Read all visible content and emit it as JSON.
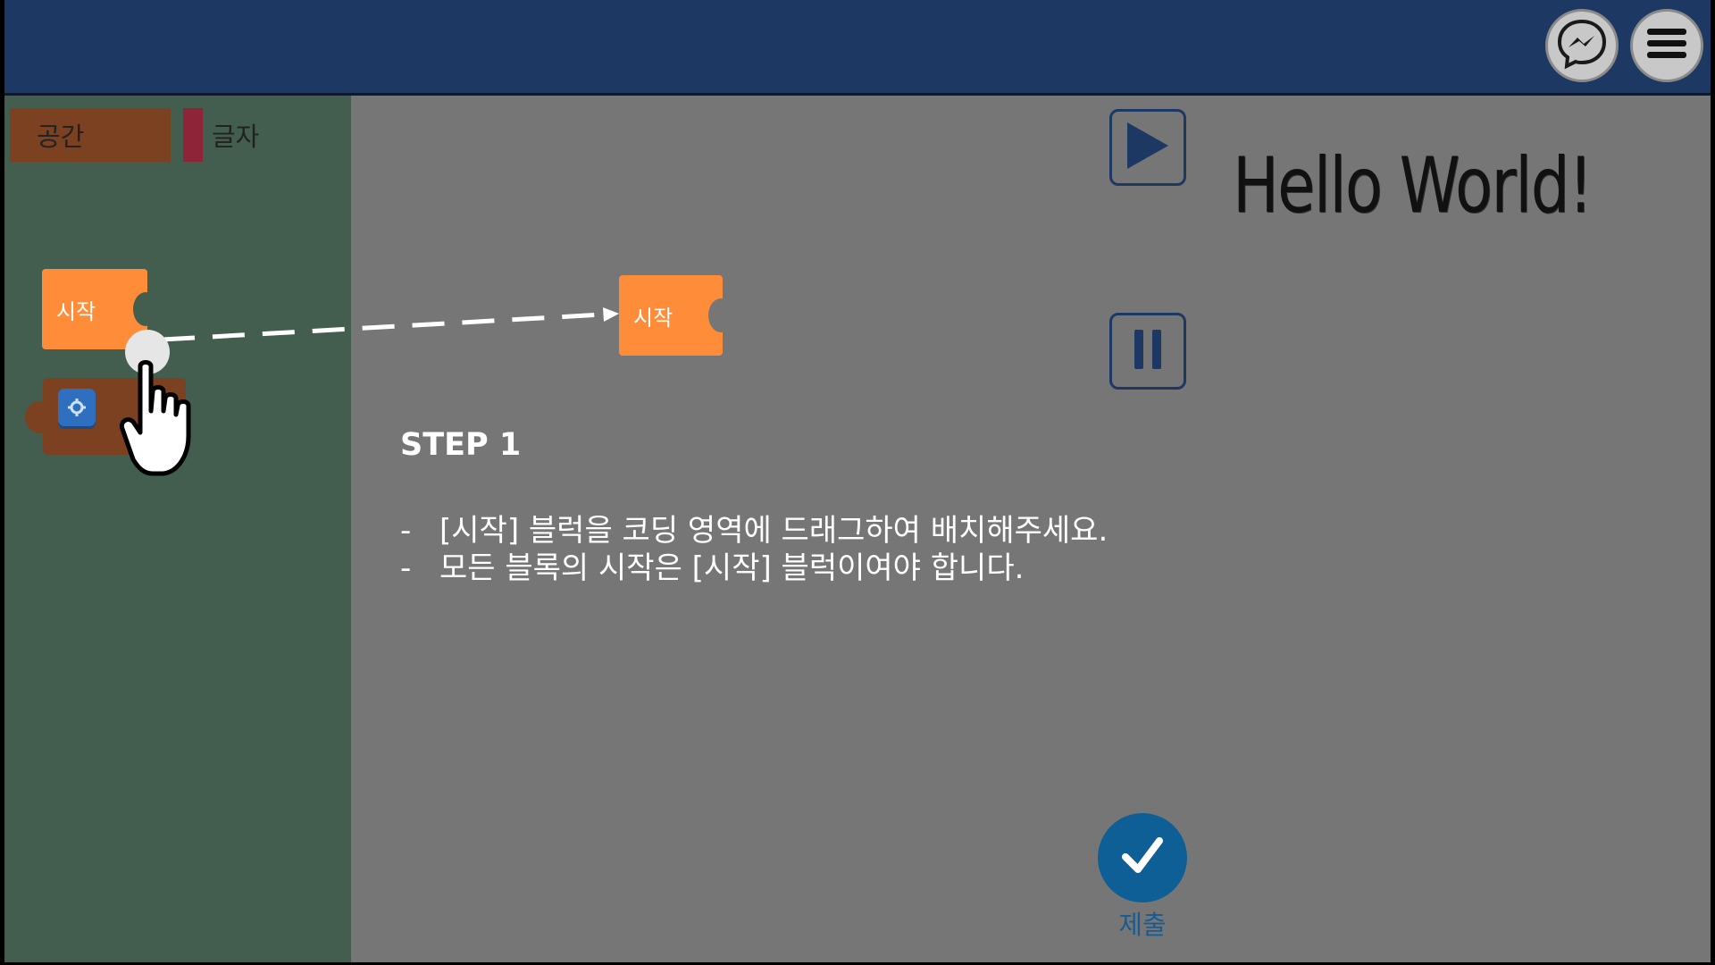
{
  "sidebar": {
    "categories": [
      {
        "label": "공간",
        "color": "#7b4120"
      },
      {
        "label": "글자",
        "color": "#8e2437"
      }
    ],
    "blocks": [
      {
        "label": "시작",
        "color": "#ff8c39"
      }
    ]
  },
  "workspace": {
    "placed_block": {
      "label": "시작"
    },
    "output_text": "Hello World!"
  },
  "controls": {
    "play_icon": "play-icon",
    "pause_icon": "pause-icon"
  },
  "header": {
    "icons": [
      "messenger-icon",
      "menu-icon"
    ]
  },
  "instructions": {
    "step_title": "STEP 1",
    "lines": [
      "[시작] 블럭을 코딩 영역에 드래그하여 배치해주세요.",
      "모든 블록의 시작은 [시작] 블럭이여야 합니다."
    ]
  },
  "submit": {
    "label": "제출"
  },
  "colors": {
    "header": "#1d3863",
    "sidebar": "#435e4e",
    "workspace": "#767676",
    "start_block": "#ff8c39",
    "submit": "#0e5f96"
  }
}
